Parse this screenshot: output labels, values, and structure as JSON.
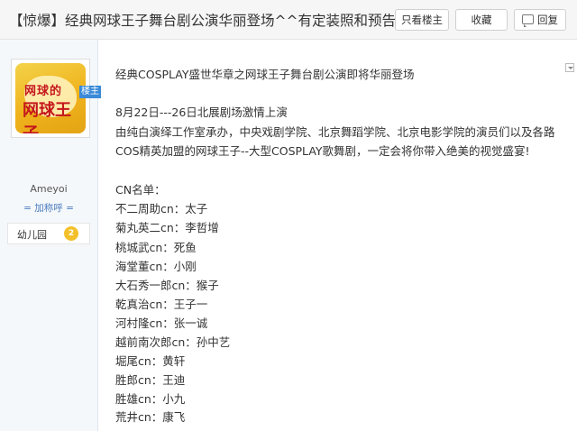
{
  "thread": {
    "title": "【惊爆】经典网球王子舞台剧公演华丽登场^^有定装照和预告片...",
    "buttons": {
      "only_op": "只看楼主",
      "favorite": "收藏",
      "reply": "回复"
    }
  },
  "author": {
    "avatar_text_top": "网球的",
    "avatar_text_main": "网球王子",
    "ribbon": "楼主",
    "username": "Ameyoi",
    "add_title": "= 加称呼 =",
    "level_name": "幼儿园",
    "level_num": "2"
  },
  "post": {
    "headline": "经典COSPLAY盛世华章之网球王子舞台剧公演即将华丽登场",
    "date_line": "8月22日---26日北展剧场激情上演",
    "body1": "由纯白演绎工作室承办，中央戏剧学院、北京舞蹈学院、北京电影学院的演员们以及各路",
    "body2": "COS精英加盟的网球王子--大型COSPLAY歌舞剧，一定会将你带入绝美的视觉盛宴!",
    "cn_title": "CN名单：",
    "cast": [
      "不二周助cn：太子",
      "菊丸英二cn：李哲增",
      "桃城武cn：死鱼",
      "海堂董cn：小刚",
      "大石秀一郎cn：猴子",
      "乾真治cn：王子一",
      "河村隆cn：张一诚",
      "越前南次郎cn：孙中艺",
      "堀尾cn：黄轩",
      "胜郎cn：王迪",
      "胜雄cn：小九",
      "荒井cn：康飞"
    ]
  },
  "icons": {
    "reply": "reply-icon",
    "level": "level-badge-icon",
    "collapse": "collapse-arrow-icon"
  }
}
